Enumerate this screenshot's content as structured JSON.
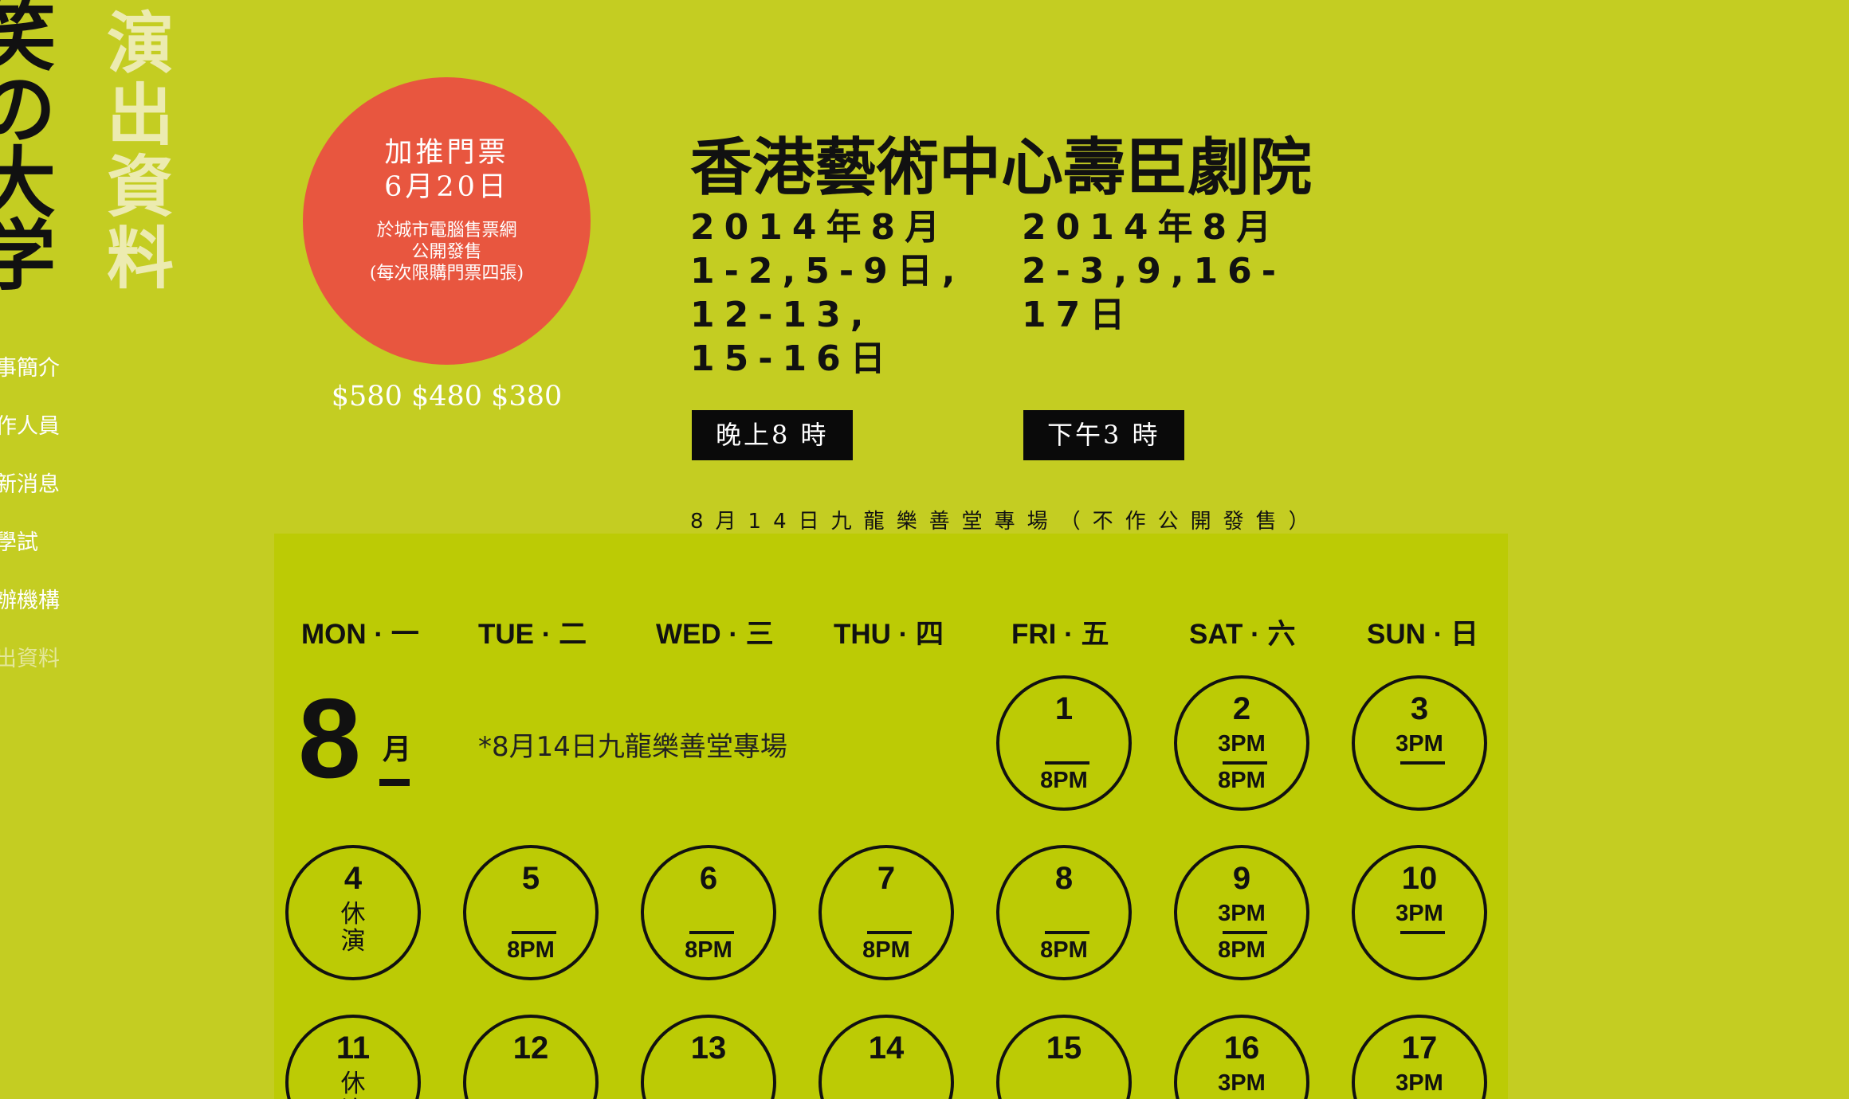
{
  "logo": {
    "text": [
      "笑",
      "の",
      "大",
      "学"
    ]
  },
  "section_title": {
    "text": [
      "演",
      "出",
      "資",
      "料"
    ]
  },
  "nav": {
    "items": [
      "事簡介",
      "作人員",
      "新消息",
      "學試",
      "辦機構",
      "出資料"
    ],
    "active_index": 5
  },
  "ticket": {
    "line1": "加推門票",
    "line2": "6月20日",
    "line3": "於城市電腦售票網",
    "line4": "公開發售",
    "line5": "(每次限購門票四張)",
    "prices": "$580  $480  $380"
  },
  "venue": "香港藝術中心壽臣劇院",
  "evening": {
    "dates": [
      "2014年8月",
      "1-2,5-9日,",
      "12-13,",
      "15-16日"
    ],
    "time": "晚上8 時"
  },
  "afternoon": {
    "dates": [
      "2014年8月",
      "2-3,9,16-",
      "17日"
    ],
    "time": "下午3 時"
  },
  "private_note": "8月14日九龍樂善堂專場（不作公開發售）",
  "calendar": {
    "weekdays": [
      "MON · 一",
      "TUE · 二",
      "WED · 三",
      "THU · 四",
      "FRI · 五",
      "SAT · 六",
      "SUN · 日"
    ],
    "month_number": "8",
    "month_unit": "月",
    "note": "*8月14日九龍樂善堂專場",
    "days": [
      {
        "day": "1",
        "top": "",
        "bottom": "8PM"
      },
      {
        "day": "2",
        "top": "3PM",
        "bottom": "8PM"
      },
      {
        "day": "3",
        "top": "3PM",
        "bottom": ""
      },
      {
        "day": "4",
        "rest": "休演"
      },
      {
        "day": "5",
        "top": "",
        "bottom": "8PM"
      },
      {
        "day": "6",
        "top": "",
        "bottom": "8PM"
      },
      {
        "day": "7",
        "top": "",
        "bottom": "8PM"
      },
      {
        "day": "8",
        "top": "",
        "bottom": "8PM"
      },
      {
        "day": "9",
        "top": "3PM",
        "bottom": "8PM"
      },
      {
        "day": "10",
        "top": "3PM",
        "bottom": ""
      },
      {
        "day": "11",
        "rest": "休演"
      },
      {
        "day": "12",
        "top": "",
        "bottom": ""
      },
      {
        "day": "13",
        "top": "",
        "bottom": ""
      },
      {
        "day": "14",
        "top": "",
        "bottom": "",
        "star": "*"
      },
      {
        "day": "15",
        "top": "",
        "bottom": ""
      },
      {
        "day": "16",
        "top": "3PM",
        "bottom": ""
      },
      {
        "day": "17",
        "top": "3PM",
        "bottom": ""
      }
    ]
  },
  "colors": {
    "background": "#c4cd22",
    "calendar_panel": "#bccb05",
    "circle_red": "#e8563f",
    "title_pale": "#ecebb0"
  }
}
